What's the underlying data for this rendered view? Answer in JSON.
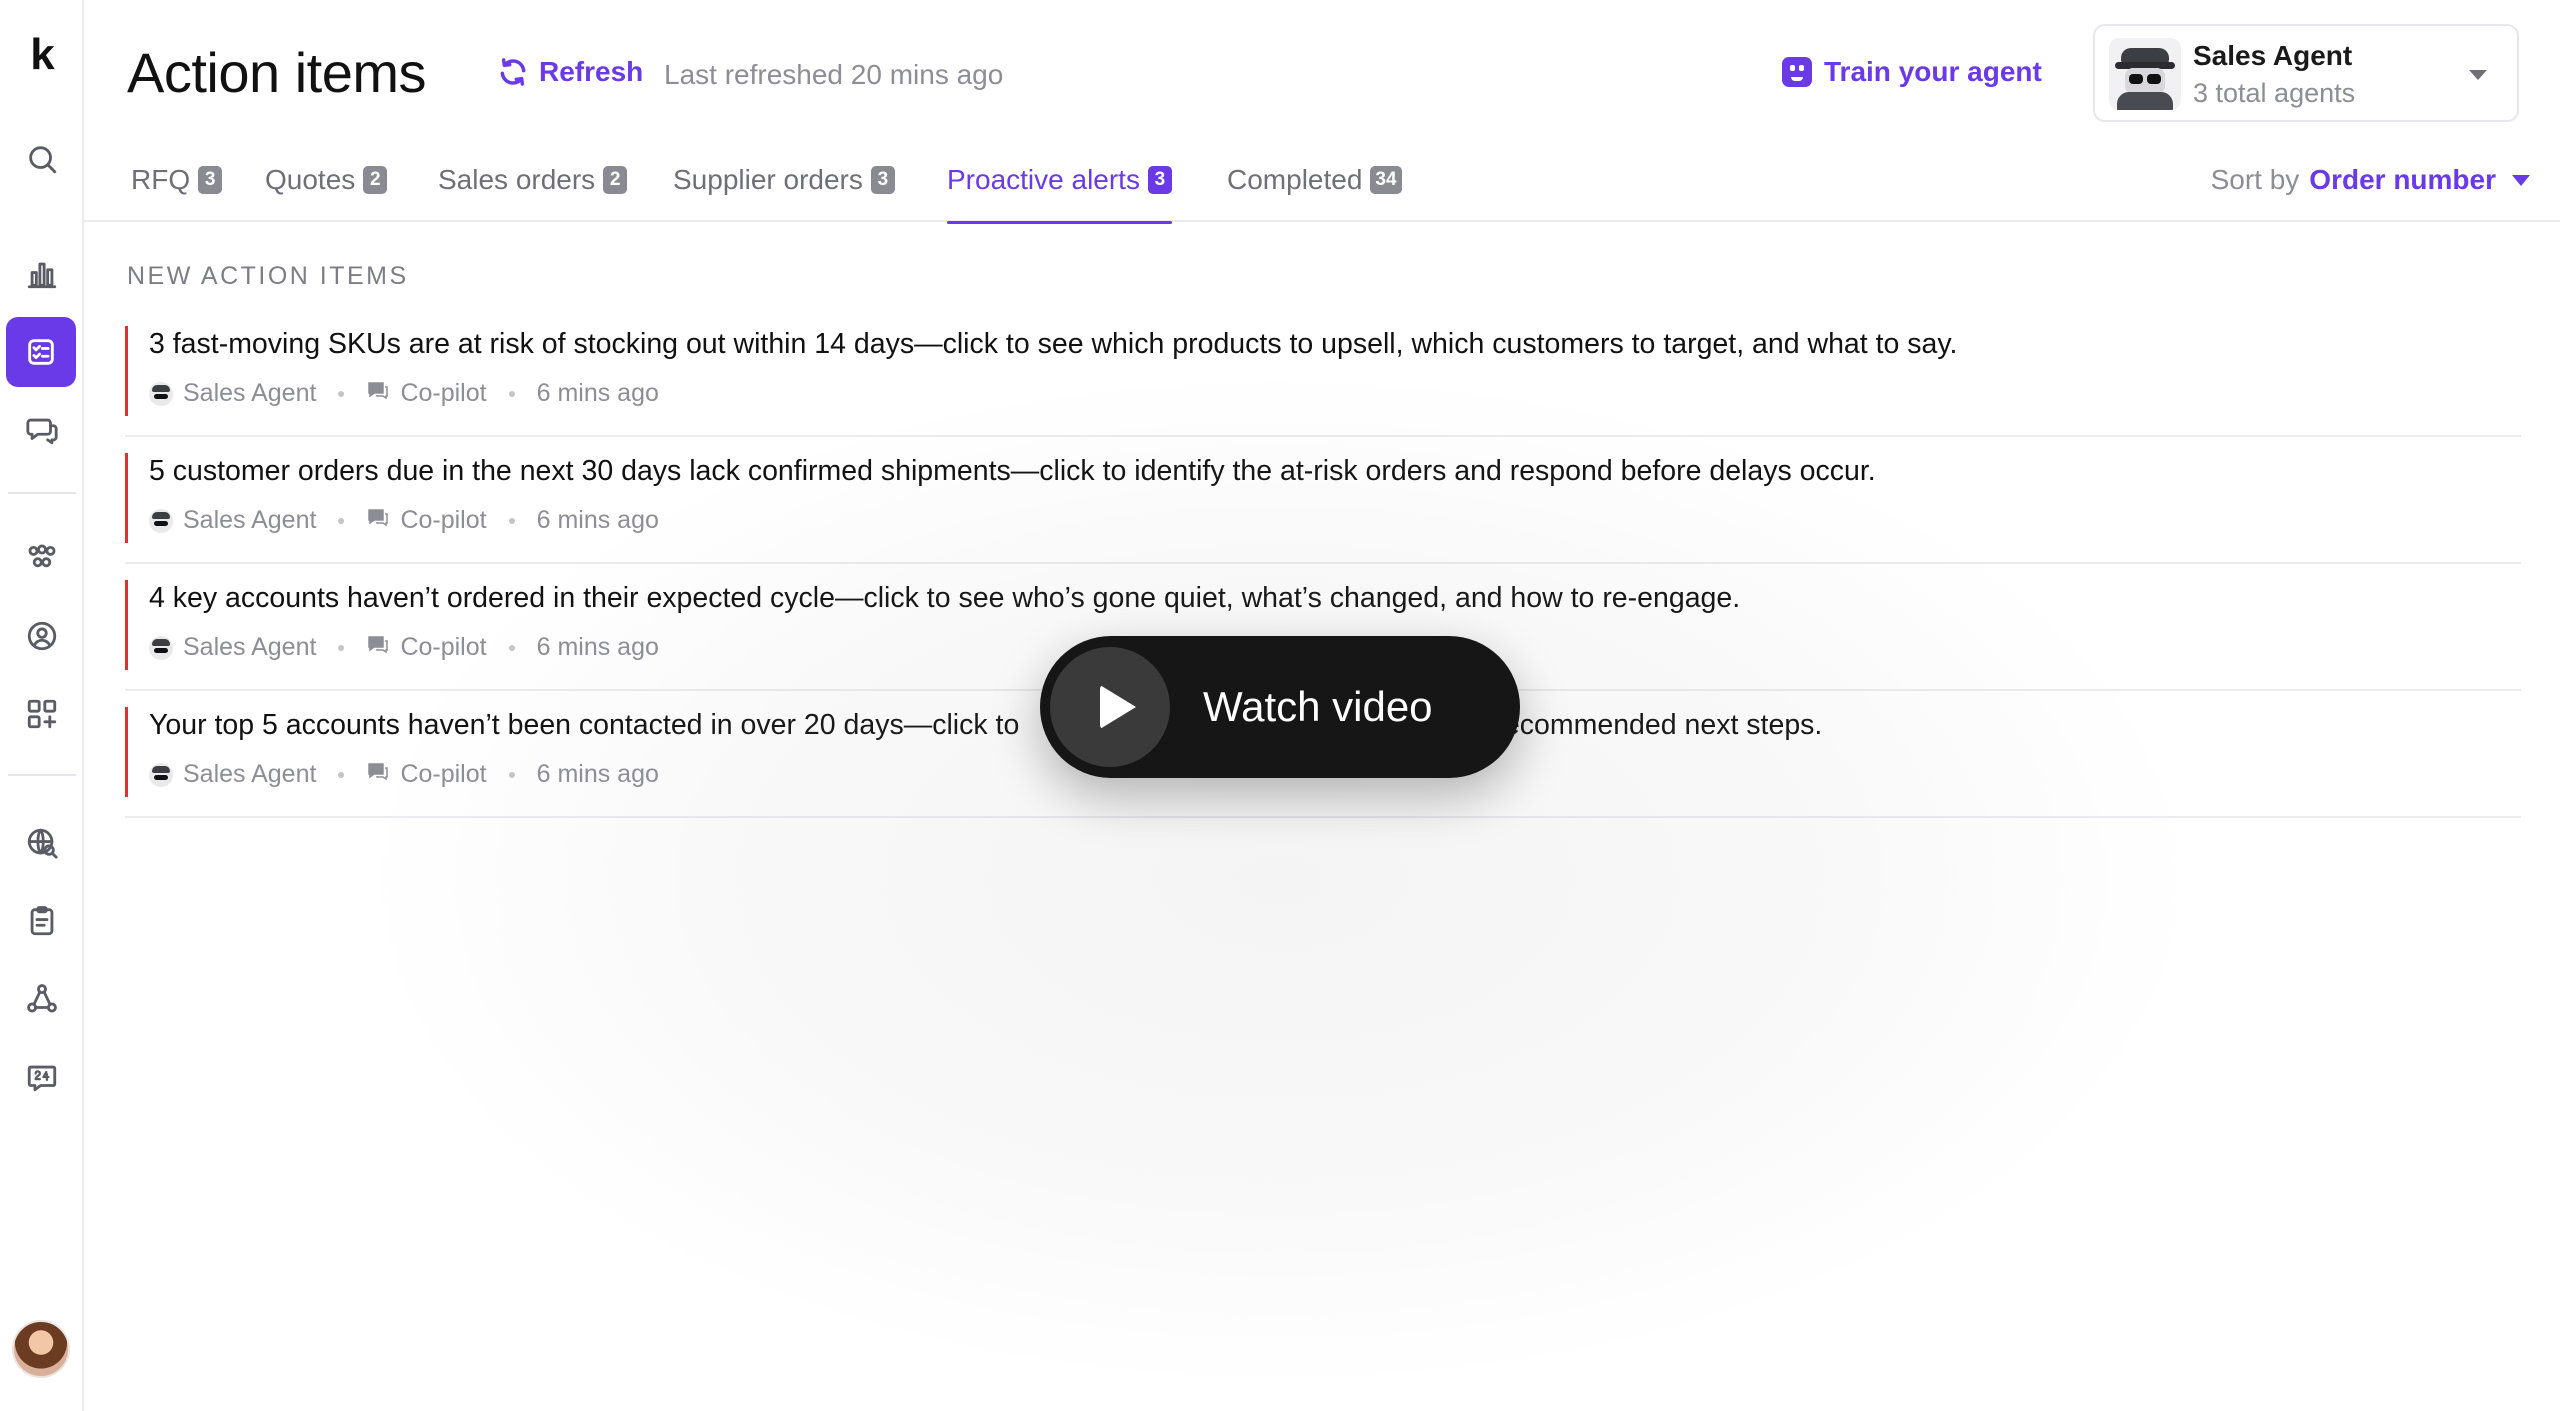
{
  "sidebar": {
    "logo": "k",
    "items": [
      {
        "name": "search-icon"
      },
      {
        "name": "bar-chart-icon"
      },
      {
        "name": "checklist-icon",
        "active": true
      },
      {
        "name": "chat-bubbles-icon"
      },
      {
        "name": "team-icon"
      },
      {
        "name": "user-badge-icon"
      },
      {
        "name": "apps-add-icon"
      },
      {
        "name": "globe-search-icon"
      },
      {
        "name": "clipboard-icon"
      },
      {
        "name": "network-icon"
      },
      {
        "name": "support-24-icon"
      }
    ]
  },
  "header": {
    "title": "Action items",
    "refresh_label": "Refresh",
    "last_refreshed": "Last refreshed 20 mins ago",
    "train_label": "Train your agent",
    "agent": {
      "name": "Sales Agent",
      "subtitle": "3 total agents"
    }
  },
  "tabs": [
    {
      "label": "RFQ",
      "count": "3"
    },
    {
      "label": "Quotes",
      "count": "2"
    },
    {
      "label": "Sales orders",
      "count": "2"
    },
    {
      "label": "Supplier orders",
      "count": "3"
    },
    {
      "label": "Proactive alerts",
      "count": "3",
      "active": true
    },
    {
      "label": "Completed",
      "count": "34"
    }
  ],
  "sort": {
    "label": "Sort by",
    "value": "Order number"
  },
  "section_label": "NEW ACTION ITEMS",
  "items": [
    {
      "title": "3 fast-moving SKUs are at risk of stocking out within 14 days—click to see which products to upsell, which customers to target, and what to say.",
      "agent": "Sales Agent",
      "source": "Co-pilot",
      "time": "6 mins ago"
    },
    {
      "title": "5 customer orders due in the next 30 days lack confirmed shipments—click to identify the at-risk orders and respond before delays occur.",
      "agent": "Sales Agent",
      "source": "Co-pilot",
      "time": "6 mins ago"
    },
    {
      "title": "4 key accounts haven’t ordered in their expected cycle—click to see who’s gone quiet, what’s changed, and how to re-engage.",
      "agent": "Sales Agent",
      "source": "Co-pilot",
      "time": "6 mins ago"
    },
    {
      "title": "Your top 5 accounts haven’t been contacted in over 20 days—click to                                                            recommended next steps.",
      "agent": "Sales Agent",
      "source": "Co-pilot",
      "time": "6 mins ago"
    }
  ],
  "video_overlay": {
    "label": "Watch video"
  },
  "colors": {
    "accent": "#6a39e8",
    "alert_bar": "#d9362b",
    "overlay_bg": "#161616"
  }
}
